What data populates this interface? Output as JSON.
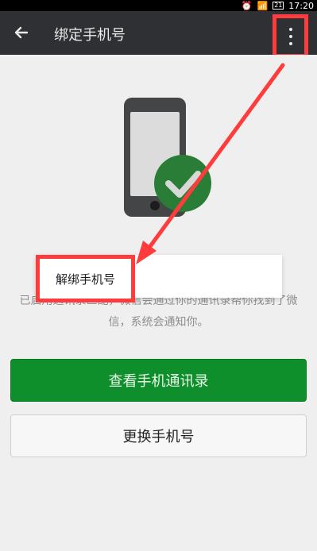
{
  "status_bar": {
    "sim_label": "21",
    "time": "17:20"
  },
  "app_bar": {
    "title": "绑定手机号"
  },
  "description": {
    "line1": "已启用通讯录匹配，微信会通过你的通讯录帮你找到了微",
    "line2": "信，系统会通知你。"
  },
  "overflow_menu": {
    "unbind_label": "解绑手机号"
  },
  "buttons": {
    "view_contacts": "查看手机通讯录",
    "change_phone": "更换手机号"
  },
  "colors": {
    "primary_green": "#0f8f2b",
    "highlight_red": "#ff3b3b"
  },
  "icons": {
    "back": "arrow-left-icon",
    "more": "more-vert-icon",
    "check": "check-circle-icon",
    "phone": "phone-icon"
  }
}
